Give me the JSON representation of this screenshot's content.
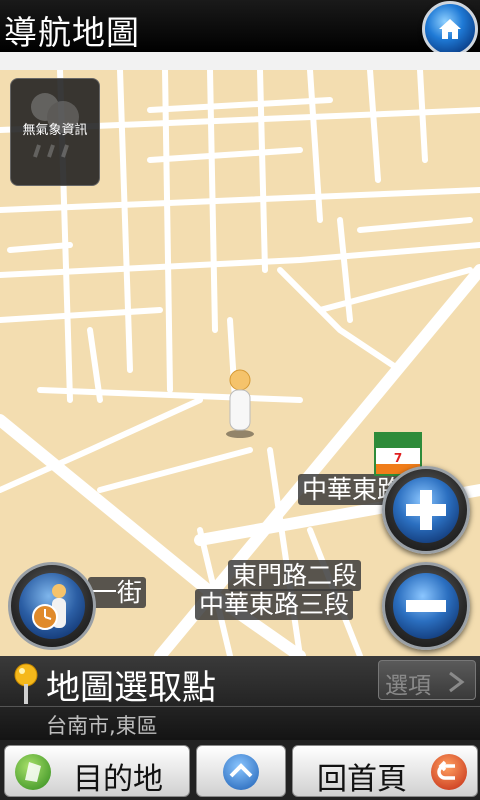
{
  "header": {
    "title": "導航地圖",
    "home_icon": "home-icon"
  },
  "weather": {
    "label": "無氣象資訊",
    "icon": "weather-cloud-rain-icon"
  },
  "map": {
    "labels": [
      "中華東路",
      "東門路二段",
      "中華東路三段",
      "一街"
    ],
    "store_icon": "7-eleven-icon"
  },
  "info": {
    "title": "地圖選取點",
    "address": "台南市,東區",
    "option_label": "選項"
  },
  "bottom": {
    "destination_label": "目的地",
    "home_label": "回首頁"
  },
  "colors": {
    "map_bg": "#f3ddb0",
    "road": "#ffffff",
    "accent": "#2b6fc0"
  }
}
